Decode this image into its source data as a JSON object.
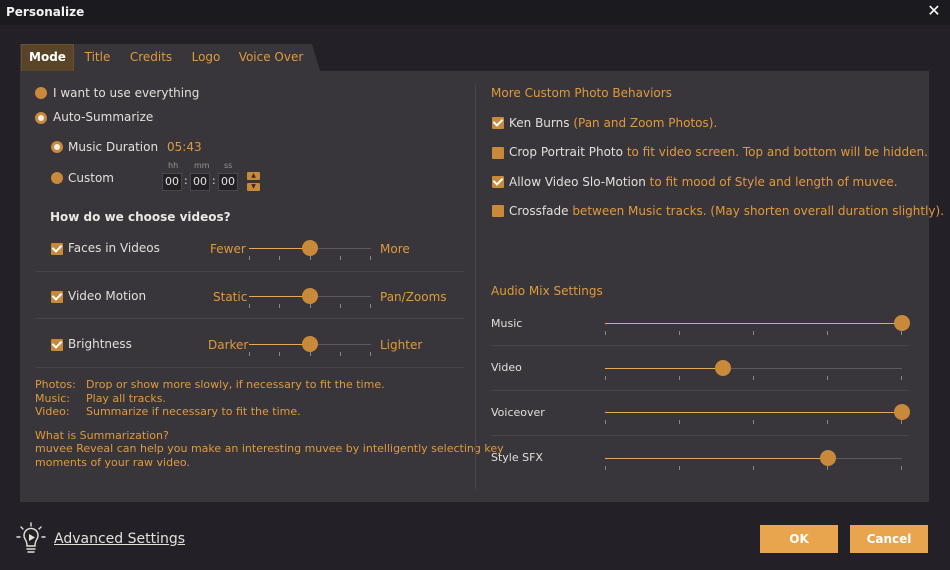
{
  "window": {
    "title": "Personalize"
  },
  "tabs": [
    {
      "label": "Mode",
      "active": true
    },
    {
      "label": "Title"
    },
    {
      "label": "Credits"
    },
    {
      "label": "Logo"
    },
    {
      "label": "Voice Over"
    }
  ],
  "mode": {
    "use_everything": "I want to use everything",
    "auto_summarize": "Auto-Summarize",
    "music_duration_label": "Music Duration",
    "music_duration_value": "05:43",
    "custom_label": "Custom",
    "time_labels": {
      "hh": "hh",
      "mm": "mm",
      "ss": "ss"
    },
    "time_values": {
      "hh": "00",
      "mm": "00",
      "ss": "00"
    },
    "colon": ":"
  },
  "choose": {
    "heading": "How do we choose videos?",
    "items": [
      {
        "label": "Faces in Videos",
        "left": "Fewer",
        "right": "More",
        "checked": true,
        "level": 0.5
      },
      {
        "label": "Video Motion",
        "left": "Static",
        "right": "Pan/Zooms",
        "checked": true,
        "level": 0.5
      },
      {
        "label": "Brightness",
        "left": "Darker",
        "right": "Lighter",
        "checked": true,
        "level": 0.5
      }
    ]
  },
  "notes": {
    "photos_key": "Photos:",
    "photos_val": "Drop or show more slowly, if necessary to fit the time.",
    "music_key": "Music:",
    "music_val": "Play all tracks.",
    "video_key": "Video:",
    "video_val": "Summarize if necessary to fit the time.",
    "what_q": "What is Summarization?",
    "what_a1": "muvee Reveal can help you make an interesting muvee by intelligently selecting key",
    "what_a2": "moments of your raw video."
  },
  "photo": {
    "heading": "More Custom Photo Behaviors",
    "items": [
      {
        "label": "Ken Burns",
        "desc": "(Pan and Zoom Photos).",
        "checked": true
      },
      {
        "label": "Crop Portrait Photo",
        "desc": "to fit video screen. Top and bottom will be hidden.",
        "checked": false
      },
      {
        "label": "Allow Video Slo-Motion",
        "desc": "to fit mood of Style and length of muvee.",
        "checked": true
      },
      {
        "label": "Crossfade",
        "desc": "between Music tracks. (May shorten overall duration slightly).",
        "checked": false
      }
    ]
  },
  "audio": {
    "heading": "Audio Mix Settings",
    "items": [
      {
        "label": "Music",
        "level": 1.0
      },
      {
        "label": "Video",
        "level": 0.4
      },
      {
        "label": "Voiceover",
        "level": 1.0
      },
      {
        "label": "Style SFX",
        "level": 0.75
      }
    ]
  },
  "footer": {
    "advanced": "Advanced Settings",
    "ok": "OK",
    "cancel": "Cancel",
    "bulb_icon": "lightbulb-play-icon"
  },
  "colors": {
    "accent": "#e09a3c",
    "thumb": "#c8893a",
    "button": "#e9a54e"
  }
}
